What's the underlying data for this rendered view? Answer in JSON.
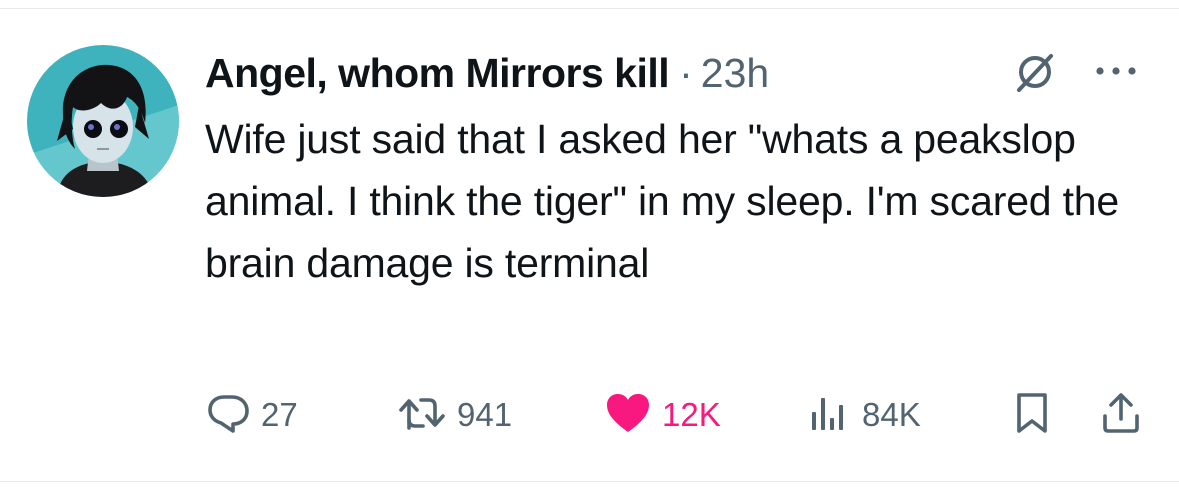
{
  "tweet": {
    "author_name": "Angel, whom Mirrors kill",
    "separator": "·",
    "timestamp": "23h",
    "text": "Wife just said that I asked her \"whats a peakslop animal. I think the tiger\" in my sleep. I'm scared the brain damage is terminal"
  },
  "header_icons": {
    "grok": "grok-slash-circle-icon",
    "more": "more-dots-icon"
  },
  "actions": {
    "reply": {
      "icon": "reply-bubble-icon",
      "count": "27"
    },
    "repost": {
      "icon": "repost-arrows-icon",
      "count": "941"
    },
    "like": {
      "icon": "heart-filled-icon",
      "count": "12K",
      "active": true
    },
    "views": {
      "icon": "views-bars-icon",
      "count": "84K"
    },
    "bookmark": {
      "icon": "bookmark-icon"
    },
    "share": {
      "icon": "share-upload-icon"
    }
  },
  "colors": {
    "text_primary": "#0f1419",
    "text_secondary": "#536471",
    "like_active": "#f91880",
    "divider": "#e7e9ea",
    "avatar_bg": "#3fb3bd"
  }
}
